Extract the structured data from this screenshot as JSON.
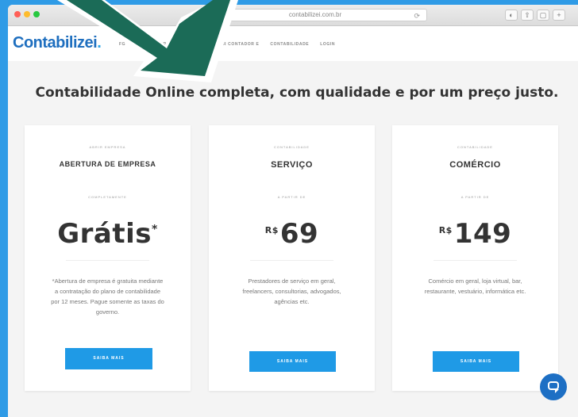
{
  "browser": {
    "url": "contabilizei.com.br"
  },
  "brand": {
    "name": "Contabilizei",
    "dot": "."
  },
  "nav": {
    "links": [
      "FG",
      "ABRIR EMPRESA GRÁTIS",
      "TROCAR CONTADOR E",
      "CONTABILIDADE",
      "LOGIN"
    ]
  },
  "headline": "Contabilidade Online completa, com qualidade e por um preço justo.",
  "cards": [
    {
      "sub": "ABRIR EMPRESA",
      "title": "ABERTURA DE EMPRESA",
      "apartir": "COMPLETAMENTE",
      "price": "Grátis",
      "price_mark": "*",
      "desc": "*Abertura de empresa é gratuita mediante a contratação do plano de contabilidade por 12 meses. Pague somente as taxas do governo.",
      "button": "SAIBA MAIS"
    },
    {
      "sub": "CONTABILIDADE",
      "title": "SERVIÇO",
      "apartir": "A PARTIR DE",
      "currency": "R$",
      "price": "69",
      "desc": "Prestadores de serviço em geral, freelancers, consultorias, advogados, agências etc.",
      "button": "SAIBA MAIS"
    },
    {
      "sub": "CONTABILIDADE",
      "title": "COMÉRCIO",
      "apartir": "A PARTIR DE",
      "currency": "R$",
      "price": "149",
      "desc": "Comércio em geral, loja virtual, bar, restaurante, vestuário, informática etc.",
      "button": "SAIBA MAIS"
    }
  ],
  "colors": {
    "accent": "#1f9ae6",
    "brand": "#1f6fbf",
    "arrow_fill": "#1b6b57",
    "frame": "#2f9be6"
  },
  "icons": {
    "chat": "chat-icon",
    "arrow": "pointer-arrow"
  }
}
